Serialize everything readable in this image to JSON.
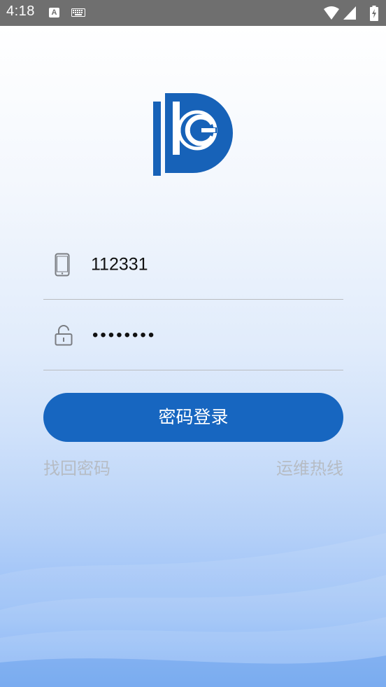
{
  "status_bar": {
    "time": "4:18",
    "a_icon_label": "A",
    "icons": [
      "a-notification-icon",
      "keyboard-icon",
      "wifi-icon",
      "cellular-signal-icon",
      "battery-charging-icon"
    ]
  },
  "logo": {
    "brand_color": "#1762b8"
  },
  "login_form": {
    "phone_value": "112331",
    "password_value": "••••••••",
    "phone_icon": "phone-icon",
    "lock_icon": "lock-icon",
    "login_button_label": "密码登录",
    "forgot_password_label": "找回密码",
    "hotline_label": "运维热线"
  },
  "colors": {
    "primary_button": "#1766c0",
    "link_text": "#b6bcc4",
    "divider": "#b9bcc0"
  }
}
